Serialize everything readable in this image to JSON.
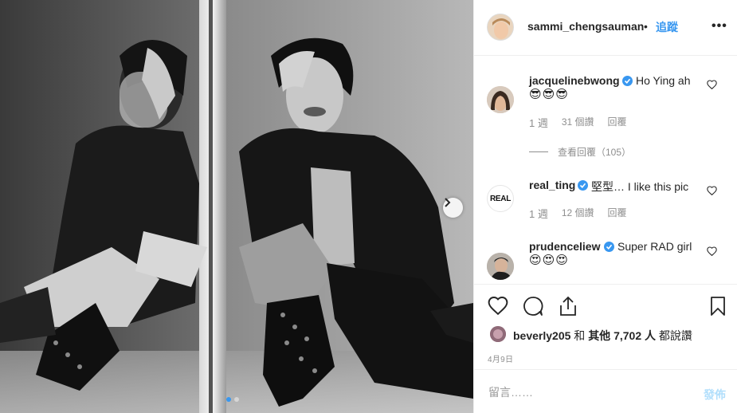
{
  "post": {
    "username": "sammi_chengsauman",
    "separator": "•",
    "follow_label": "追蹤",
    "more_label": "•••",
    "carousel_dots": 2,
    "carousel_active": 0
  },
  "comments": [
    {
      "username": "jacquelinebwong",
      "verified": true,
      "text": "Ho Ying ah",
      "emoji": "😎😎😎",
      "time": "1 週",
      "likes": "31 個讚",
      "reply_label": "回覆",
      "view_replies": "查看回覆（105）"
    },
    {
      "username": "real_ting",
      "verified": true,
      "text": "堅型… I like this pic",
      "avatar_text": "REAL",
      "time": "1 週",
      "likes": "12 個讚",
      "reply_label": "回覆"
    },
    {
      "username": "prudenceliew",
      "verified": true,
      "text": "Super RAD girl",
      "emoji": "😍😍😍"
    }
  ],
  "likes": {
    "user": "beverly205",
    "middle": " 和 ",
    "others": "其他 7,702 人",
    "suffix": " 都說讚"
  },
  "date": "4月9日",
  "add_comment": {
    "placeholder": "留言……",
    "post_label": "發佈"
  },
  "colors": {
    "accent": "#3897f0",
    "text": "#262626",
    "muted": "#8e8e8e",
    "border": "#efefef"
  }
}
